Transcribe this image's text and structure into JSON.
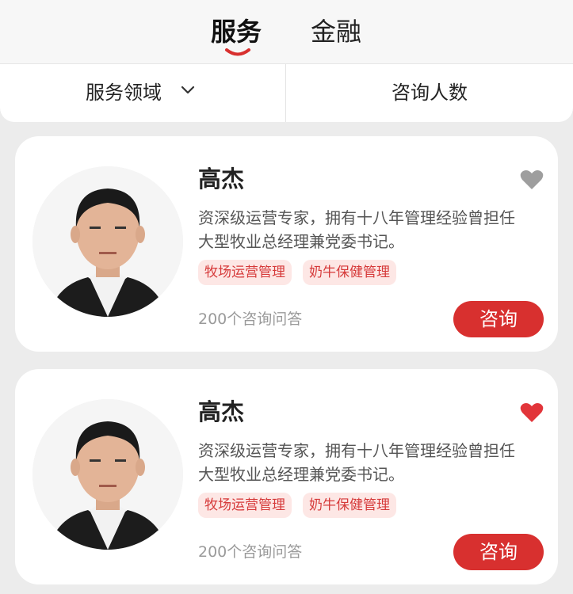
{
  "tabs": {
    "active": "服务",
    "inactive": "金融"
  },
  "filters": {
    "domain": "服务领域",
    "count": "咨询人数"
  },
  "colors": {
    "accent": "#d8302f",
    "tag_bg": "#fde7e5",
    "tag_text": "#d63a3a",
    "heart_inactive": "#9e9e9e",
    "heart_active": "#e2353a"
  },
  "experts": [
    {
      "name": "高杰",
      "bio_line1": "资深级运营专家，拥有十八年管理经验曾担任",
      "bio_line2": "大型牧业总经理兼党委书记。",
      "tags": [
        "牧场运营管理",
        "奶牛保健管理"
      ],
      "qa_count": "200个咨询问答",
      "button": "咨询",
      "favorited": false,
      "heart_icon": "heart-outline-gray"
    },
    {
      "name": "高杰",
      "bio_line1": "资深级运营专家，拥有十八年管理经验曾担任",
      "bio_line2": "大型牧业总经理兼党委书记。",
      "tags": [
        "牧场运营管理",
        "奶牛保健管理"
      ],
      "qa_count": "200个咨询问答",
      "button": "咨询",
      "favorited": true,
      "heart_icon": "heart-filled-red"
    }
  ]
}
